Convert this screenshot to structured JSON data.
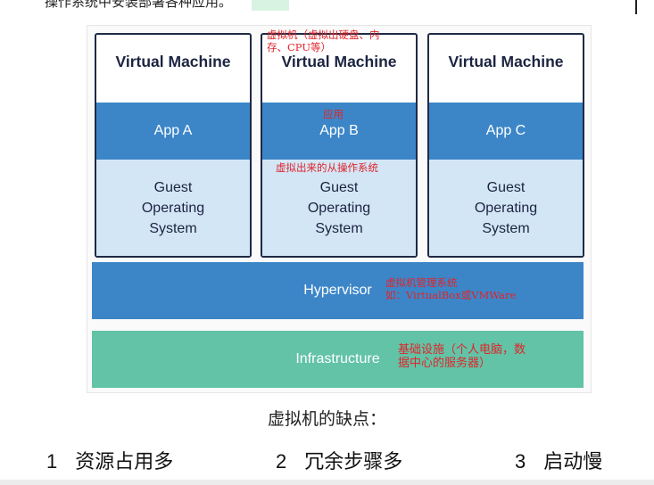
{
  "top_text": "操作系统中安装部署各种应用。",
  "figure": {
    "vms": [
      {
        "title": "Virtual Machine",
        "app": "App A",
        "guest": "Guest\nOperating\nSystem"
      },
      {
        "title": "Virtual Machine",
        "app": "App B",
        "guest": "Guest\nOperating\nSystem"
      },
      {
        "title": "Virtual Machine",
        "app": "App C",
        "guest": "Guest\nOperating\nSystem"
      }
    ],
    "hypervisor": "Hypervisor",
    "infrastructure": "Infrastructure"
  },
  "annotations": {
    "vm": "虚拟机（虚拟出硬盘、内\n存、CPU等）",
    "app": "应用",
    "guest_os": "虚拟出来的从操作系统",
    "hypervisor": "虚拟机管理系统\n如：VirtualBox或VMWare",
    "infrastructure": "基础设施（个人电脑，数\n据中心的服务器）"
  },
  "caption": "虚拟机的缺点：",
  "drawbacks": [
    {
      "num": "1",
      "text": "资源占用多"
    },
    {
      "num": "2",
      "text": "冗余步骤多"
    },
    {
      "num": "3",
      "text": "启动慢"
    }
  ],
  "colors": {
    "accent_blue": "#3c86c8",
    "light_blue": "#d3e6f6",
    "green": "#62c3a6",
    "annotation_red": "#e0242a"
  }
}
